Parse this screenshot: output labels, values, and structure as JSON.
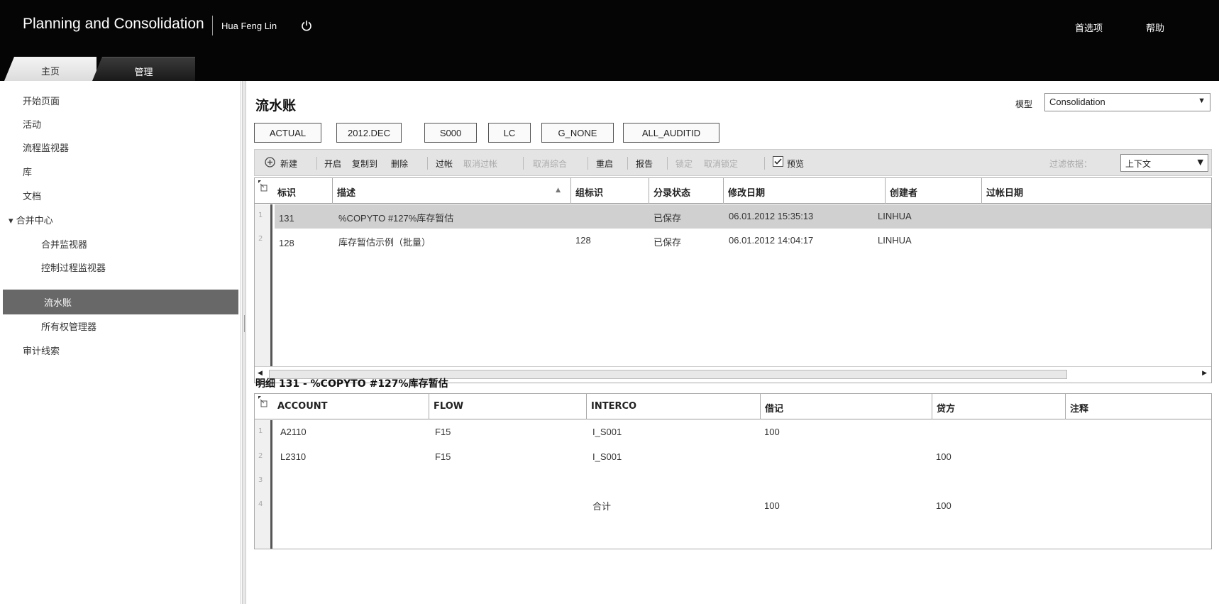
{
  "header": {
    "app_title": "Planning and Consolidation",
    "user_name": "Hua Feng Lin",
    "preferences_label": "首选项",
    "help_label": "帮助"
  },
  "tabs": [
    {
      "label": "主页",
      "active": true
    },
    {
      "label": "管理",
      "active": false
    }
  ],
  "sidebar": {
    "items": [
      {
        "label": "开始页面"
      },
      {
        "label": "活动"
      },
      {
        "label": "流程监视器"
      },
      {
        "label": "库"
      },
      {
        "label": "文档"
      },
      {
        "label": "▾ 合并中心"
      },
      {
        "label": "合并监视器"
      },
      {
        "label": "控制过程监视器"
      },
      {
        "label": "流水账",
        "active": true
      },
      {
        "label": "所有权管理器"
      },
      {
        "label": "审计线索"
      }
    ]
  },
  "main": {
    "title": "流水账",
    "model_label": "模型",
    "model_value": "Consolidation",
    "context_buttons": [
      "ACTUAL",
      "2012.DEC",
      "S000",
      "LC",
      "G_NONE",
      "ALL_AUDITID"
    ],
    "toolbar": {
      "new": "新建",
      "open": "开启",
      "copy_to": "复制到",
      "delete": "删除",
      "post": "过帐",
      "unpost": "取消过帐",
      "unconsolidate": "取消综合",
      "reopen": "重启",
      "report": "报告",
      "lock": "锁定",
      "unlock": "取消锁定",
      "preview": "预览",
      "preview_checked": true,
      "filter_label": "过滤依据：",
      "filter_value": "上下文"
    },
    "journals": {
      "columns": [
        "标识",
        "描述",
        "组标识",
        "分录状态",
        "修改日期",
        "创建者",
        "过帐日期"
      ],
      "rows": [
        {
          "num": "1",
          "id": "131",
          "desc": "%COPYTO #127%库存暂估",
          "group": "",
          "status": "已保存",
          "modified": "06.01.2012 15:35:13",
          "creator": "LINHUA",
          "posted": ""
        },
        {
          "num": "2",
          "id": "128",
          "desc": "库存暂估示例（批量）",
          "group": "128",
          "status": "已保存",
          "modified": "06.01.2012 14:04:17",
          "creator": "LINHUA",
          "posted": ""
        }
      ]
    },
    "detail": {
      "title": "明细 131 - %COPYTO #127%库存暂估",
      "columns": [
        "ACCOUNT",
        "FLOW",
        "INTERCO",
        "借记",
        "贷方",
        "注释"
      ],
      "rows": [
        {
          "num": "1",
          "account": "A2110",
          "flow": "F15",
          "interco": "I_S001",
          "debit": "100",
          "credit": "",
          "comment": ""
        },
        {
          "num": "2",
          "account": "L2310",
          "flow": "F15",
          "interco": "I_S001",
          "debit": "",
          "credit": "100",
          "comment": ""
        },
        {
          "num": "3",
          "account": "",
          "flow": "",
          "interco": "",
          "debit": "",
          "credit": "",
          "comment": ""
        },
        {
          "num": "4",
          "account": "",
          "flow": "",
          "interco": "合计",
          "debit": "100",
          "credit": "100",
          "comment": ""
        }
      ]
    }
  }
}
